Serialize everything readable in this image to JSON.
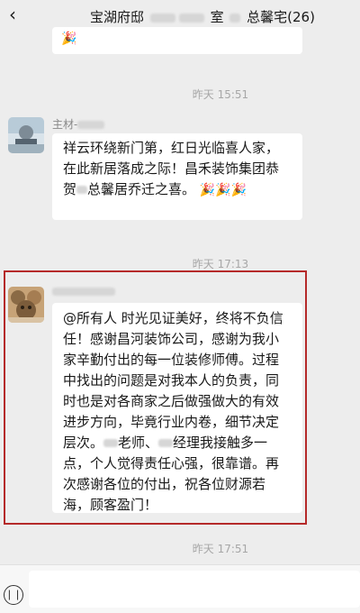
{
  "header": {
    "back_icon": "chevron-left-icon",
    "title_prefix": "宝湖府邸",
    "title_mid": "室",
    "title_suffix": "总馨宅(26)"
  },
  "messages": [
    {
      "type": "bubble_fragment",
      "emoji": "🎉"
    },
    {
      "type": "time",
      "text": "昨天 15:51"
    },
    {
      "type": "message",
      "sender": "主材-",
      "text": "祥云环绕新门第，红日光临喜人家，在此新居落成之际！昌禾装饰集团恭贺",
      "text_suffix": "总馨居乔迁之喜。"
    },
    {
      "type": "time",
      "text": "昨天 17:13"
    },
    {
      "type": "message",
      "sender": "",
      "text": "@所有人 时光见证美好，终将不负信任！感谢昌河装饰公司，感谢为我小家辛勤付出的每一位装修师傅。过程中找出的问题是对我本人的负责，同时也是对各商家之后做强做大的有效进步方向，毕竟行业内卷，细节决定层次。",
      "text_mid": "老师、",
      "text_tail": "经理我接触多一点，个人觉得责任心强，很靠谱。再次感谢各位的付出，祝各位财源若海，顾客盈门！"
    },
    {
      "type": "time",
      "text": "昨天 17:51"
    }
  ],
  "footer": {
    "voice_icon": "voice-input-icon"
  }
}
